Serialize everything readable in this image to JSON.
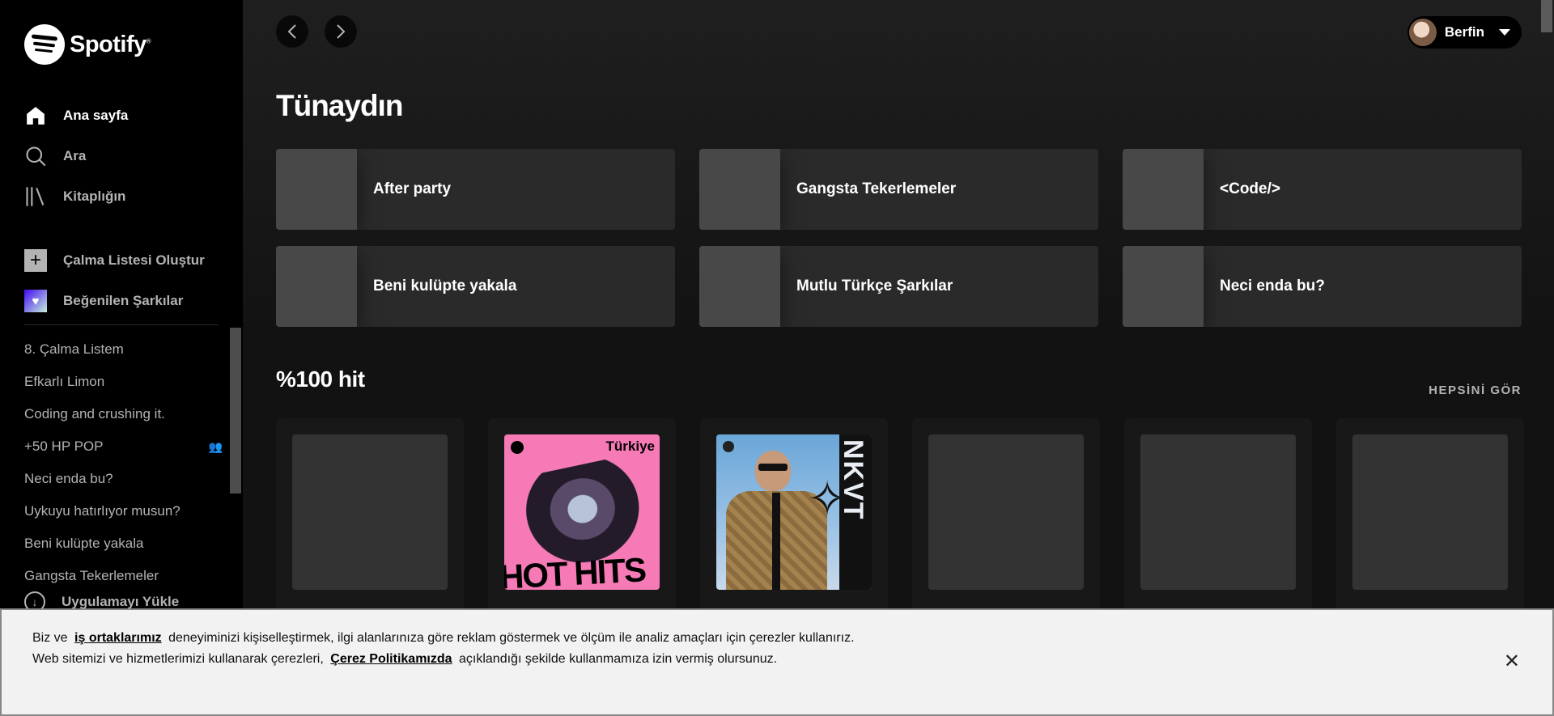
{
  "brand": {
    "name": "Spotify",
    "mark": "®"
  },
  "sidebar": {
    "nav": [
      {
        "label": "Ana sayfa",
        "icon": "home-icon",
        "active": true
      },
      {
        "label": "Ara",
        "icon": "search-icon",
        "active": false
      },
      {
        "label": "Kitaplığın",
        "icon": "library-icon",
        "active": false
      }
    ],
    "actions": [
      {
        "label": "Çalma Listesi Oluştur",
        "icon": "plus-icon"
      },
      {
        "label": "Beğenilen Şarkılar",
        "icon": "heart-icon"
      }
    ],
    "playlists": [
      {
        "label": "8. Çalma Listem"
      },
      {
        "label": "Efkarlı Limon"
      },
      {
        "label": "Coding and crushing it."
      },
      {
        "label": "+50 HP POP",
        "collaborative": true
      },
      {
        "label": "Neci enda bu?"
      },
      {
        "label": "Uykuyu hatırlıyor musun?"
      },
      {
        "label": "Beni kulüpte yakala"
      },
      {
        "label": "Gangsta Tekerlemeler"
      }
    ],
    "install_label": "Uygulamayı Yükle"
  },
  "header": {
    "user_name": "Berfin"
  },
  "main": {
    "greeting": "Tünaydın",
    "shortcuts": [
      {
        "label": "After party"
      },
      {
        "label": "Gangsta Tekerlemeler"
      },
      {
        "label": "<Code/>"
      },
      {
        "label": "Beni kulüpte yakala"
      },
      {
        "label": "Mutlu Türkçe Şarkılar"
      },
      {
        "label": "Neci enda bu?"
      }
    ],
    "section": {
      "title": "%100 hit",
      "see_all": "HEPSİNİ GÖR",
      "cards": [
        {
          "art": "placeholder"
        },
        {
          "art": "hot-hits",
          "country": "Türkiye",
          "art_text": "HOT HITS"
        },
        {
          "art": "nkvt",
          "art_text": "NKVT"
        },
        {
          "art": "placeholder"
        },
        {
          "art": "placeholder"
        },
        {
          "art": "placeholder"
        }
      ]
    }
  },
  "cookie": {
    "text_1": "Biz ve",
    "link_1": "iş ortaklarımız",
    "text_2": "deneyiminizi kişiselleştirmek, ilgi alanlarınıza göre reklam göstermek ve ölçüm ile analiz amaçları için çerezler kullanırız. Web sitemizi ve hizmetlerimizi kullanarak çerezleri,",
    "link_2": "Çerez Politikamızda",
    "text_3": "açıklandığı şekilde kullanmamıza izin vermiş olursunuz.",
    "close": "✕"
  },
  "colors": {
    "background": "#121212",
    "sidebar": "#000000",
    "card": "#181818",
    "shortcut": "#2a2a2a",
    "muted_text": "#b3b3b3"
  }
}
